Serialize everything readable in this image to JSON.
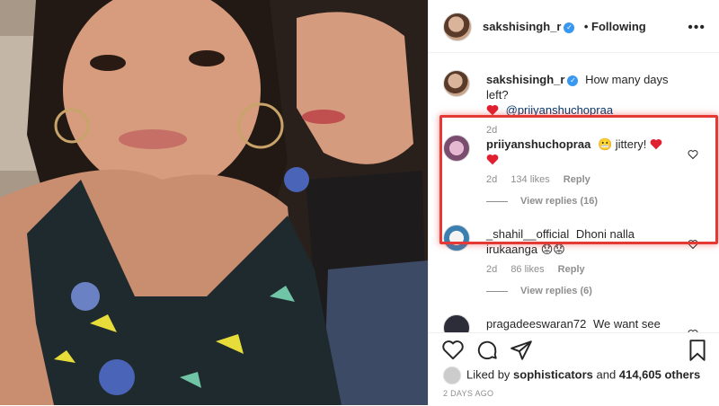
{
  "post": {
    "author": "sakshisingh_r",
    "follow_status": "• Following",
    "verified_mark": "✓"
  },
  "comments": [
    {
      "user": "sakshisingh_r",
      "text": "How many days left?",
      "mention": "@priiyanshuchopraa",
      "age": "2d"
    },
    {
      "user": "priiyanshuchopraa",
      "text": "😬 jittery!",
      "age": "2d",
      "likes": "134 likes",
      "reply": "Reply",
      "view_replies": "View replies (16)"
    },
    {
      "user": "_shahil__official",
      "text": "Dhoni nalla irukaanga 😟😟",
      "age": "2d",
      "likes": "86 likes",
      "reply": "Reply",
      "view_replies": "View replies (6)"
    },
    {
      "user": "pragadeeswaran72",
      "text": "We want see"
    }
  ],
  "engagement": {
    "liked_by_prefix": "Liked by",
    "liked_by_user": "sophisticators",
    "and_text": "and",
    "others": "414,605 others",
    "date": "2 DAYS AGO"
  },
  "colors": {
    "highlight": "#e53935",
    "heart": "#ed4956",
    "verified": "#3897f0"
  },
  "icons": [
    "more-icon",
    "heart-icon",
    "comment-icon",
    "share-icon",
    "bookmark-icon"
  ]
}
